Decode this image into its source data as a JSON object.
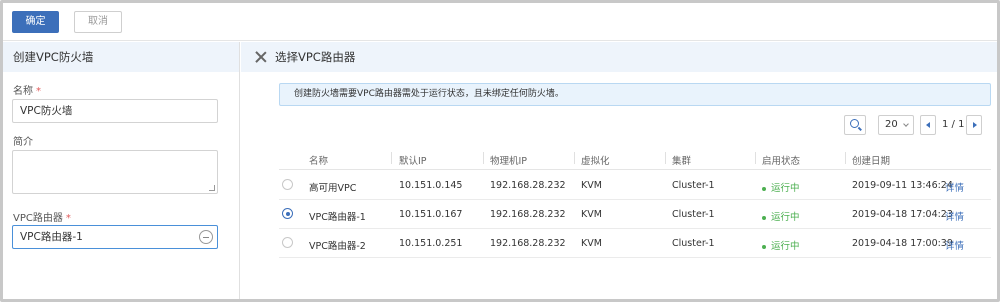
{
  "toolbar": {
    "confirm_label": "确定",
    "cancel_label": "取消"
  },
  "left_panel": {
    "title": "创建VPC防火墙",
    "name_label": "名称",
    "name_value": "VPC防火墙",
    "desc_label": "简介",
    "desc_value": "",
    "router_label": "VPC路由器",
    "router_value": "VPC路由器-1",
    "required_mark": "*"
  },
  "right_panel": {
    "title": "选择VPC路由器",
    "notice": "创建防火墙需要VPC路由器需处于运行状态，且未绑定任何防火墙。",
    "page_size": "20",
    "page_indicator": "1 / 1",
    "columns": [
      "名称",
      "默认IP",
      "物理机IP",
      "虚拟化",
      "集群",
      "启用状态",
      "创建日期"
    ],
    "rows": [
      {
        "selected": false,
        "name": "高可用VPC",
        "default_ip": "10.151.0.145",
        "host_ip": "192.168.28.232",
        "hypervisor": "KVM",
        "cluster": "Cluster-1",
        "status": "运行中",
        "created": "2019-09-11 13:46:24",
        "action": "详情"
      },
      {
        "selected": true,
        "name": "VPC路由器-1",
        "default_ip": "10.151.0.167",
        "host_ip": "192.168.28.232",
        "hypervisor": "KVM",
        "cluster": "Cluster-1",
        "status": "运行中",
        "created": "2019-04-18 17:04:23",
        "action": "详情"
      },
      {
        "selected": false,
        "name": "VPC路由器-2",
        "default_ip": "10.151.0.251",
        "host_ip": "192.168.28.232",
        "hypervisor": "KVM",
        "cluster": "Cluster-1",
        "status": "运行中",
        "created": "2019-04-18 17:00:39",
        "action": "详情"
      }
    ]
  },
  "colors": {
    "primary": "#3c6fba",
    "running": "#4caf50",
    "header_bg": "#eef4fb",
    "notice_bg": "#e9f3fc"
  },
  "icons": {
    "close": "close-icon",
    "search": "search-icon",
    "minus": "minus-circle-icon",
    "prev": "triangle-left-icon",
    "next": "triangle-right-icon",
    "dropdown": "chevron-down-icon"
  }
}
